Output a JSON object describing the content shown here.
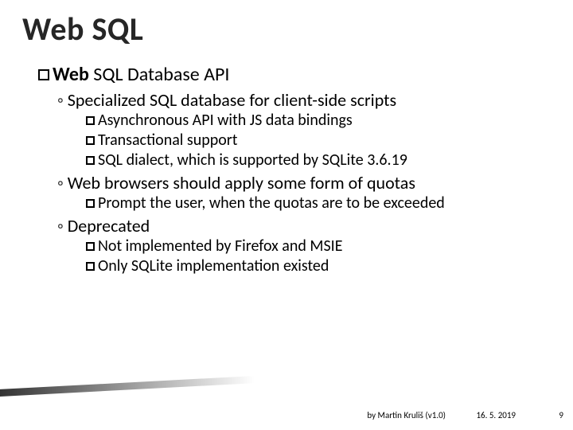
{
  "title": "Web SQL",
  "heading_prefix": "Web",
  "heading_rest": " SQL Database API",
  "bullets": {
    "l1_a": "Specialized SQL database for client-side scripts",
    "l2_a1": "Asynchronous API with JS data bindings",
    "l2_a2": "Transactional support",
    "l2_a3": "SQL dialect, which is supported by SQLite 3.6.19",
    "l1_b": "Web browsers should apply some form of quotas",
    "l2_b1": "Prompt the user, when the quotas are to be exceeded",
    "l1_c": "Deprecated",
    "l2_c1": "Not implemented by Firefox and MSIE",
    "l2_c2": "Only SQLite implementation existed"
  },
  "footer": {
    "author": "by Martin Kruliš (v1.0)",
    "date": "16. 5. 2019",
    "page": "9"
  }
}
